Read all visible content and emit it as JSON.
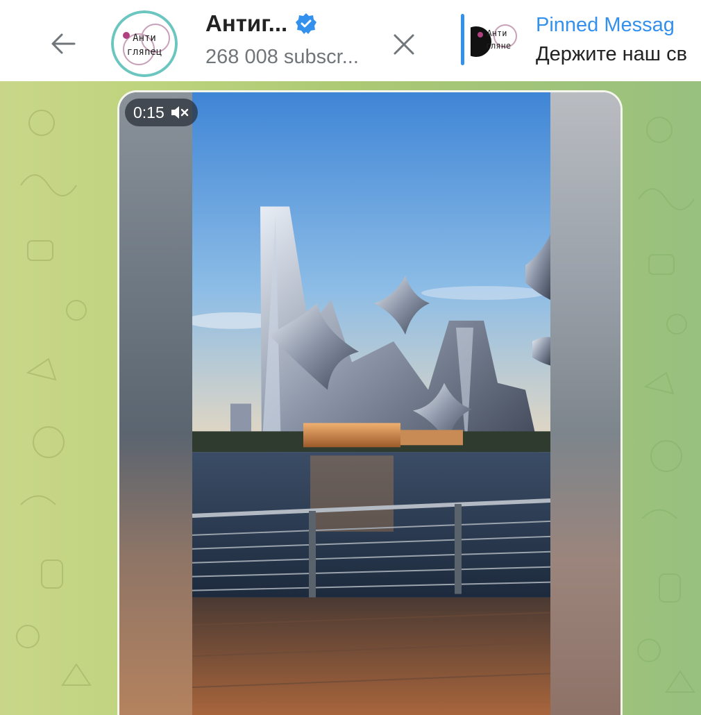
{
  "header": {
    "channel_title": "Антиг...",
    "subscribers": "268 008 subscr...",
    "avatar_text_top": "Анти",
    "avatar_text_bottom": "гляneц",
    "pinned": {
      "title": "Pinned Messag",
      "text": "Держите наш св",
      "thumb_text_top": "Анти",
      "thumb_text_bottom": "гляне"
    }
  },
  "video": {
    "duration": "0:15",
    "muted": true
  },
  "colors": {
    "accent": "#3390ec",
    "title": "#222222",
    "secondary": "#707579",
    "chat_bg_left": "#c9d68a",
    "chat_bg_right": "#98c07f"
  },
  "icons": [
    "back-arrow-icon",
    "verified-icon",
    "close-icon",
    "mute-icon"
  ]
}
